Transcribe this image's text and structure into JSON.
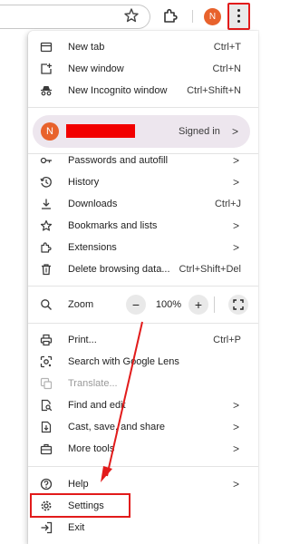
{
  "toolbar": {
    "profile_initial": "N"
  },
  "menu": {
    "new_tab": {
      "label": "New tab",
      "shortcut": "Ctrl+T"
    },
    "new_window": {
      "label": "New window",
      "shortcut": "Ctrl+N"
    },
    "new_incognito": {
      "label": "New Incognito window",
      "shortcut": "Ctrl+Shift+N"
    },
    "profile": {
      "initial": "N",
      "status": "Signed in"
    },
    "passwords": {
      "label": "Passwords and autofill"
    },
    "history": {
      "label": "History"
    },
    "downloads": {
      "label": "Downloads",
      "shortcut": "Ctrl+J"
    },
    "bookmarks": {
      "label": "Bookmarks and lists"
    },
    "extensions": {
      "label": "Extensions"
    },
    "delete_data": {
      "label": "Delete browsing data...",
      "shortcut": "Ctrl+Shift+Del"
    },
    "zoom": {
      "label": "Zoom",
      "minus": "−",
      "value": "100%",
      "plus": "+"
    },
    "print": {
      "label": "Print...",
      "shortcut": "Ctrl+P"
    },
    "lens": {
      "label": "Search with Google Lens"
    },
    "translate": {
      "label": "Translate..."
    },
    "find_edit": {
      "label": "Find and edit"
    },
    "cast_save": {
      "label": "Cast, save, and share"
    },
    "more_tools": {
      "label": "More tools"
    },
    "help": {
      "label": "Help"
    },
    "settings": {
      "label": "Settings"
    },
    "exit": {
      "label": "Exit"
    }
  },
  "colors": {
    "highlight": "#e21b1b",
    "profile_bg": "#ede6ee",
    "avatar": "#e8622c",
    "redaction": "#f20000"
  }
}
